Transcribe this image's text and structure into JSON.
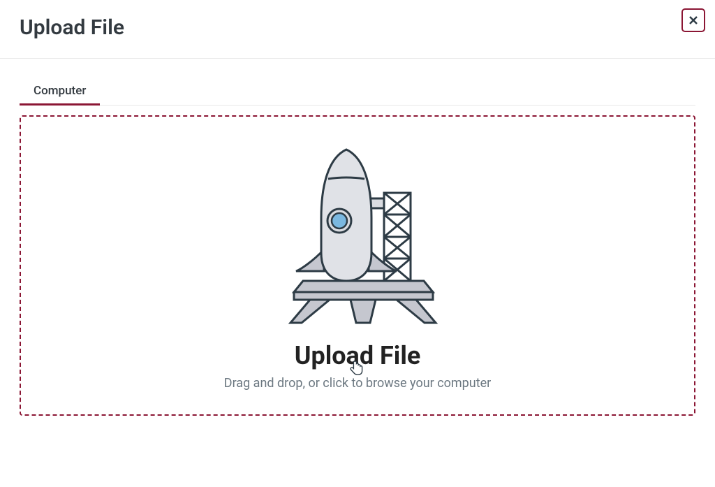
{
  "header": {
    "title": "Upload File"
  },
  "tabs": {
    "items": [
      {
        "label": "Computer"
      }
    ]
  },
  "dropzone": {
    "title": "Upload File",
    "subtitle": "Drag and drop, or click to browse your computer"
  },
  "colors": {
    "accent": "#8b1634"
  }
}
